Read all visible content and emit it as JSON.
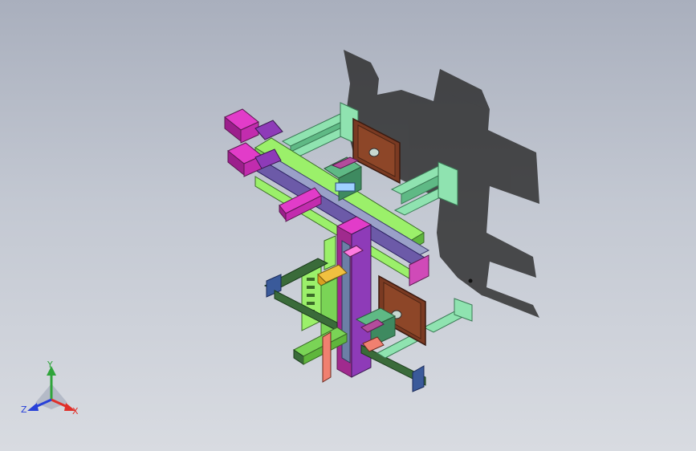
{
  "viewport": {
    "background_top": "#a9afbd",
    "background_bottom": "#d8dbe1"
  },
  "model": {
    "description_icon": "cad-assembly-icon",
    "colors": {
      "mint": "#8fe3b0",
      "mint_dark": "#5fb985",
      "lime": "#9bf06a",
      "lime_dark": "#5fb63c",
      "magenta": "#e23cc9",
      "magenta_dark": "#9c1f8c",
      "purple": "#8e3bb8",
      "brown": "#7a3a22",
      "brown_light": "#a85a3a",
      "olive": "#3a6b3a",
      "yellow": "#f0c040",
      "steel": "#6c7fa6",
      "shadow": "#2b2b2b"
    }
  },
  "triad": {
    "icon": "coordinate-triad-icon",
    "x_label": "X",
    "y_label": "Y",
    "z_label": "Z",
    "x_color": "#e0302a",
    "y_color": "#2fa43a",
    "z_color": "#2740d8"
  }
}
